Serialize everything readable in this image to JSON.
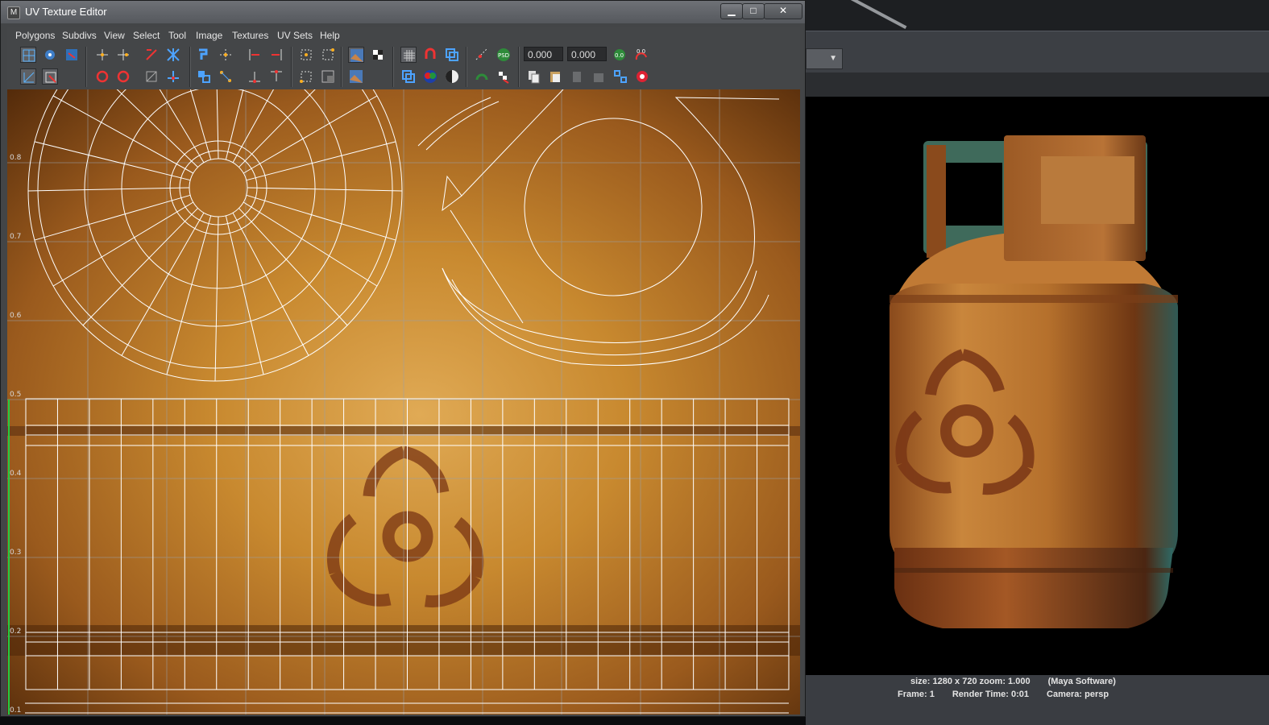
{
  "window": {
    "title": "UV Texture Editor",
    "controls": {
      "minimize": "▁",
      "maximize": "□",
      "close": "✕"
    }
  },
  "menu": [
    "Polygons",
    "Subdivs",
    "View",
    "Select",
    "Tool",
    "Image",
    "Textures",
    "UV Sets",
    "Help"
  ],
  "toolbar": {
    "u_value": "0.000",
    "v_value": "0.000",
    "icons_row1": [
      "uv-lattice-icon",
      "uv-move-icon",
      "uv-smudge-icon",
      "flip-u-icon",
      "flip-v-icon",
      "rotate-ccw-icon",
      "cut-uv-icon",
      "sew-uv-icon",
      "layout-icon",
      "grid-uvs-icon",
      "align-left-icon",
      "align-right-icon",
      "select-shell-icon",
      "select-border-icon",
      "display-image-icon",
      "checker-icon",
      "grid-icon",
      "snap-icon",
      "isolate-icon",
      "shaded-uv-icon",
      "psd-icon",
      "reset-uv-icon",
      "pixel-snap-icon"
    ],
    "icons_row2": [
      "uv-sculpt-icon",
      "unfold-icon",
      "rotate-cw-icon",
      "rotate-ccw2-icon",
      "normalize-icon",
      "straighten-icon",
      "cut-edge-icon",
      "merge-uv-icon",
      "stack-icon",
      "distribute-icon",
      "unfold-shell-icon",
      "texture-borders-icon",
      "image-range-icon",
      "dim-image-icon",
      "rgb-channel-icon",
      "alpha-channel-icon",
      "copy-uv-icon",
      "paste-uv-icon",
      "paste-u-icon",
      "paste-v-icon",
      "uv-set-editor-icon",
      "texel-density-icon",
      "lock-icon"
    ]
  },
  "uv_axis_labels": [
    "0.8",
    "0.7",
    "0.6",
    "0.5",
    "0.4",
    "0.3",
    "0.2",
    "0.1"
  ],
  "render_view": {
    "line1_size": "size: 1280 x 720  zoom: 1.000",
    "line1_renderer": "(Maya Software)",
    "frame": "Frame: 1",
    "render_time": "Render Time: 0:01",
    "camera": "Camera: persp"
  },
  "colors": {
    "texture_light": "#d49a45",
    "texture_dark": "#6b3a12",
    "uv_wire": "#ffffff",
    "ui_panel": "#444648"
  }
}
